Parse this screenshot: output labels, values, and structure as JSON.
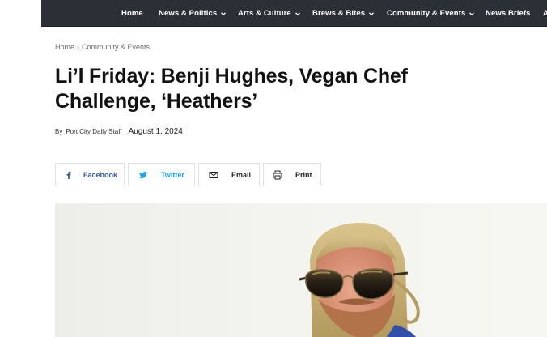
{
  "nav": {
    "items": [
      {
        "label": "Home",
        "has_dropdown": false
      },
      {
        "label": "News & Politics",
        "has_dropdown": true
      },
      {
        "label": "Arts & Culture",
        "has_dropdown": true
      },
      {
        "label": "Brews & Bites",
        "has_dropdown": true
      },
      {
        "label": "Community & Events",
        "has_dropdown": true
      },
      {
        "label": "News Briefs",
        "has_dropdown": false
      },
      {
        "label": "A",
        "has_dropdown": false
      }
    ],
    "background": "#2b3037",
    "text_color": "#ffffff"
  },
  "breadcrumb": {
    "home": "Home",
    "separator": "›",
    "current": "Community & Events"
  },
  "article": {
    "title_line1": "Li’l Friday: Benji Hughes, Vegan Chef",
    "title_line2": "Challenge, ‘Heathers’",
    "by_label": "By",
    "author": "Port City Daily Staff",
    "date": "August 1, 2024"
  },
  "share": {
    "facebook": {
      "label": "Facebook",
      "icon": "facebook-icon",
      "color": "#3b5998"
    },
    "twitter": {
      "label": "Twitter",
      "icon": "twitter-icon",
      "color": "#1da1f2"
    },
    "email": {
      "label": "Email",
      "icon": "envelope-icon",
      "color": "#222222"
    },
    "print": {
      "label": "Print",
      "icon": "printer-icon",
      "color": "#222222"
    }
  },
  "hero_image": {
    "subject": "bearded man with long blond hair wearing dark aviator sunglasses"
  }
}
